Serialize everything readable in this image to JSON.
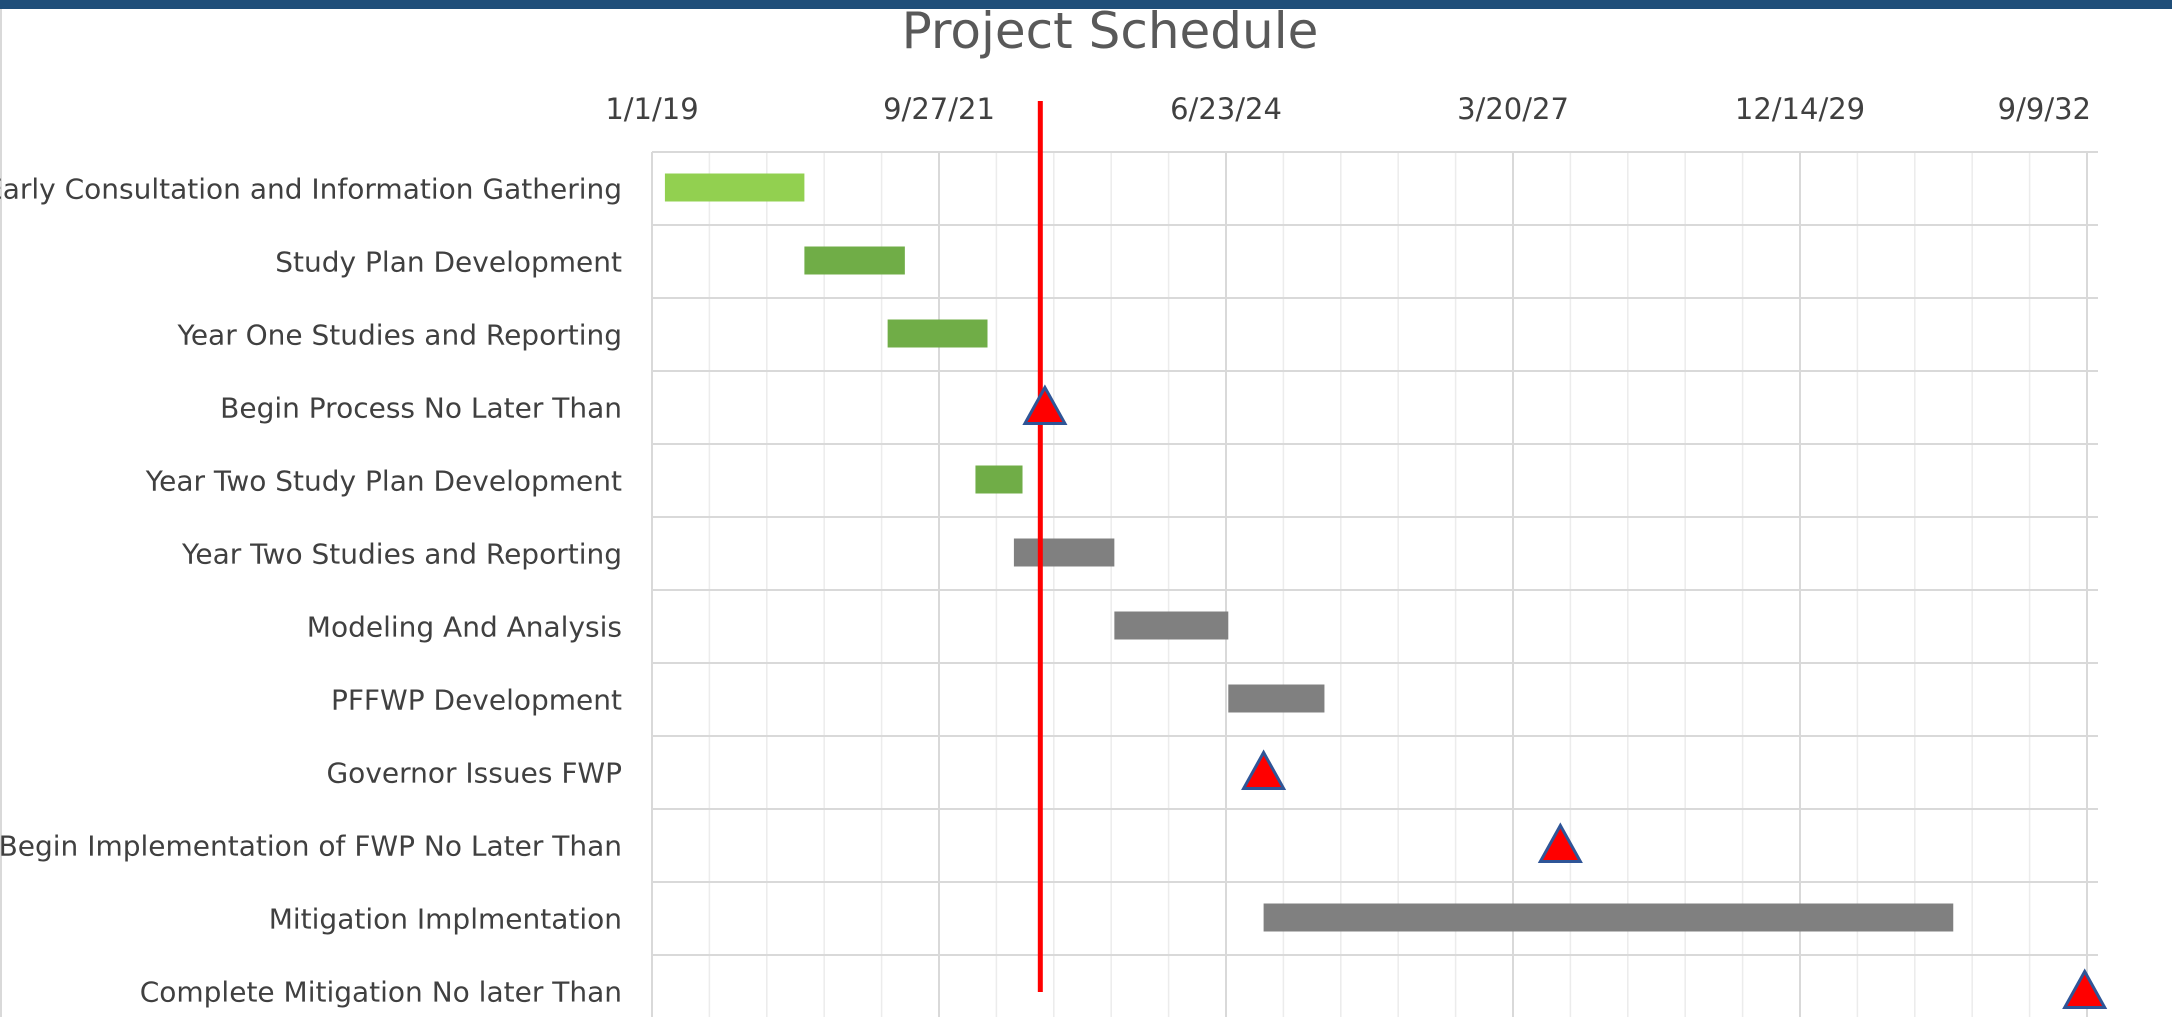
{
  "chart_data": {
    "type": "gantt",
    "title": "Project Schedule",
    "x_axis": {
      "ticks": [
        "1/1/19",
        "9/27/21",
        "6/23/24",
        "3/20/27",
        "12/14/29",
        "9/9/32"
      ],
      "range": [
        "2019-01-01",
        "2032-09-09"
      ],
      "position": "top",
      "grid": true
    },
    "today_line": {
      "date": "2022-09-15",
      "color": "#ff0000"
    },
    "colors": {
      "light_green": "#92d050",
      "green": "#70ad47",
      "gray": "#808080",
      "milestone_fill": "#ff0000",
      "milestone_border": "#2f5597"
    },
    "tasks": [
      {
        "name": "Early Consultation and Information Gathering",
        "kind": "bar",
        "start": "2019-02-15",
        "end": "2020-06-15",
        "color": "light_green"
      },
      {
        "name": "Study Plan Development",
        "kind": "bar",
        "start": "2020-06-15",
        "end": "2021-05-31",
        "color": "green"
      },
      {
        "name": "Year One  Studies and Reporting",
        "kind": "bar",
        "start": "2021-04-01",
        "end": "2022-03-15",
        "color": "green"
      },
      {
        "name": "Begin Process No Later Than",
        "kind": "milestone",
        "date": "2022-10-01"
      },
      {
        "name": "Year Two Study Plan Development",
        "kind": "bar",
        "start": "2022-02-01",
        "end": "2022-07-15",
        "color": "green"
      },
      {
        "name": "Year Two Studies and Reporting",
        "kind": "bar",
        "start": "2022-06-15",
        "end": "2023-05-31",
        "color": "gray"
      },
      {
        "name": "Modeling And Analysis",
        "kind": "bar",
        "start": "2023-05-31",
        "end": "2024-07-01",
        "color": "gray"
      },
      {
        "name": "PFFWP Development",
        "kind": "bar",
        "start": "2024-07-01",
        "end": "2025-06-01",
        "color": "gray"
      },
      {
        "name": "Governor Issues FWP",
        "kind": "milestone",
        "date": "2024-11-01"
      },
      {
        "name": "Begin Implementation of FWP No Later Than",
        "kind": "milestone",
        "date": "2027-09-01"
      },
      {
        "name": "Mitigation Implmentation",
        "kind": "bar",
        "start": "2024-11-01",
        "end": "2031-06-01",
        "color": "gray"
      },
      {
        "name": "Complete Mitigation No later Than",
        "kind": "milestone",
        "date": "2032-09-01"
      }
    ]
  }
}
